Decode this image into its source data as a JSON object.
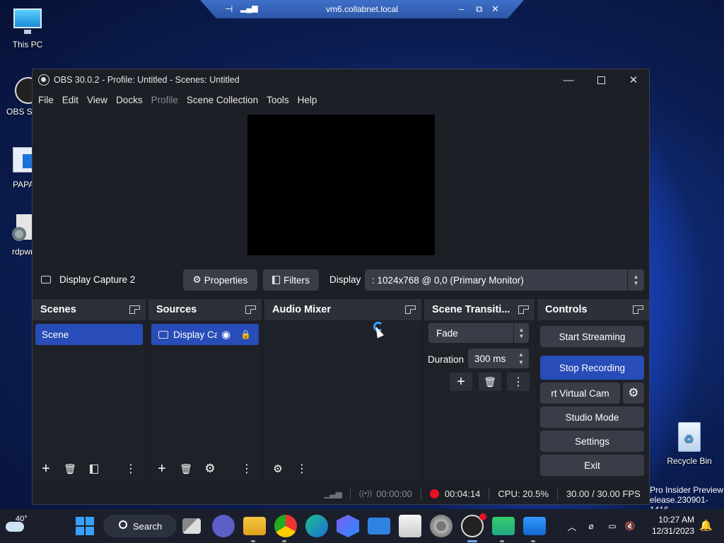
{
  "rdp": {
    "host": "vm6.collabnet.local"
  },
  "desktop": {
    "icons": [
      {
        "label": "This PC"
      },
      {
        "label": "OBS St"
      },
      {
        "label": "PAPA"
      },
      {
        "label": "rdpwr"
      },
      {
        "label": "Recycle Bin"
      }
    ],
    "watermark": [
      "Pro Insider Preview",
      "elease.230901-1416"
    ]
  },
  "obs": {
    "title": "OBS 30.0.2 - Profile: Untitled - Scenes: Untitled",
    "menu": [
      "File",
      "Edit",
      "View",
      "Docks",
      "Profile",
      "Scene Collection",
      "Tools",
      "Help"
    ],
    "source_toolbar": {
      "source_name": "Display Capture 2",
      "properties_label": "Properties",
      "filters_label": "Filters",
      "display_label": "Display",
      "display_value": ": 1024x768 @ 0,0 (Primary Monitor)"
    },
    "docks": {
      "scenes": {
        "title": "Scenes",
        "items": [
          "Scene"
        ]
      },
      "sources": {
        "title": "Sources",
        "items": [
          "Display Ca"
        ]
      },
      "mixer": {
        "title": "Audio Mixer"
      },
      "transitions": {
        "title": "Scene Transiti...",
        "transition": "Fade",
        "duration_label": "Duration",
        "duration_value": "300 ms"
      },
      "controls": {
        "title": "Controls",
        "start_streaming": "Start Streaming",
        "stop_recording": "Stop Recording",
        "virtual_cam": "rt Virtual Cam",
        "studio_mode": "Studio Mode",
        "settings": "Settings",
        "exit": "Exit"
      }
    },
    "status": {
      "stream_time": "00:00:00",
      "rec_time": "00:04:14",
      "cpu": "CPU: 20.5%",
      "fps": "30.00 / 30.00 FPS"
    }
  },
  "taskbar": {
    "weather_temp": "40°",
    "search_label": "Search",
    "clock_time": "10:27 AM",
    "clock_date": "12/31/2023"
  },
  "colors": {
    "accent": "#284cb8",
    "record": "#e81123"
  }
}
